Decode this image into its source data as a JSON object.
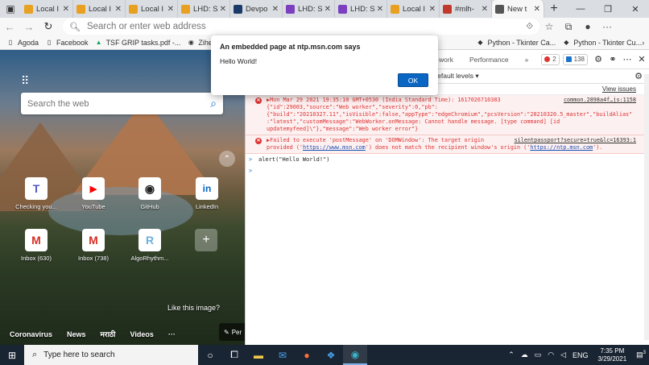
{
  "browser": {
    "tabs": [
      {
        "label": "Local I",
        "color": "#e8a020",
        "active": false
      },
      {
        "label": "Local I",
        "color": "#e8a020",
        "active": false
      },
      {
        "label": "Local I",
        "color": "#e8a020",
        "active": false
      },
      {
        "label": "LHD: S",
        "color": "#e8a020",
        "active": false
      },
      {
        "label": "Devpo",
        "color": "#1a3a6a",
        "active": false
      },
      {
        "label": "LHD: S",
        "color": "#7b3fbf",
        "active": false
      },
      {
        "label": "LHD: S",
        "color": "#7b3fbf",
        "active": false
      },
      {
        "label": "Local I",
        "color": "#e8a020",
        "active": false
      },
      {
        "label": "#mlh-",
        "color": "#c0392b",
        "active": false
      },
      {
        "label": "New t",
        "color": "#555555",
        "active": true
      }
    ],
    "address_placeholder": "Search or enter web address",
    "bookmarks": [
      "Agoda",
      "Facebook",
      "TSF GRIP tasks.pdf -...",
      "ZihengZZH",
      "Python - Tkinter Ca...",
      "Python - Tkinter Cu..."
    ]
  },
  "ntp": {
    "search_placeholder": "Search the web",
    "quick_links": [
      {
        "label": "Checking you...",
        "icon": "teams-icon",
        "glyph": "T",
        "color": "#5059c9"
      },
      {
        "label": "YouTube",
        "icon": "youtube-icon",
        "glyph": "▶",
        "color": "#ff0000"
      },
      {
        "label": "GitHub",
        "icon": "github-icon",
        "glyph": "◉",
        "color": "#222222"
      },
      {
        "label": "LinkedIn",
        "icon": "linkedin-icon",
        "glyph": "in",
        "color": "#0a66c2"
      },
      {
        "label": "Inbox (630)",
        "icon": "gmail-icon",
        "glyph": "M",
        "color": "#d93025"
      },
      {
        "label": "Inbox (738)",
        "icon": "gmail-icon",
        "glyph": "M",
        "color": "#d93025"
      },
      {
        "label": "AlgoRhythm...",
        "icon": "algorhythm-icon",
        "glyph": "R",
        "color": "#6ab0de"
      }
    ],
    "like_image": "Like this image?",
    "feed_tabs": [
      "Coronavirus",
      "News",
      "मराठी",
      "Videos",
      "···"
    ],
    "personalize": "Per"
  },
  "devtools": {
    "tabs": [
      "work",
      "Performance",
      "»"
    ],
    "error_count": "2",
    "message_count": "138",
    "levels": "Default levels ▾",
    "view_issues": "View issues",
    "errors": [
      {
        "source": "common.2898a4f…js:1158",
        "text": "▶Mon Mar 29 2021 19:35:10 GMT+0530 (India Standard Time): 1617026710383 {\"id\":29003,\"source\":\"Web worker\",\"severity\":0,\"pb\": {\"build\":\"20210327.11\",\"isVisible\":false,\"appType\":\"edgeChromium\",\"pcsVersion\":\"20210320.5_master\",\"buildAlias\" :\"latest\",\"customMessage\":\"WebWorker.onMessage: Cannot handle message. [type command] [id updatemyfeed]\\\"},\"message\":\"Web worker error\"}"
      },
      {
        "source": "silentpassport?secure=true&lc=16393:1",
        "text_pre": "▶Failed to execute 'postMessage' on 'DOMWindow': The target origin provided ('",
        "link1": "https://www.msn.com",
        "text_mid": "') does not match the recipient window's origin ('",
        "link2": "https://ntp.msn.com",
        "text_post": "')."
      }
    ],
    "console_input": "alert(\"Hello World!\")",
    "prompt_symbol": ">"
  },
  "dialog": {
    "title": "An embedded page at ntp.msn.com says",
    "message": "Hello World!",
    "ok_label": "OK"
  },
  "taskbar": {
    "search_placeholder": "Type here to search",
    "language": "ENG",
    "time": "7:35 PM",
    "date": "3/29/2021",
    "notification_count": "3"
  }
}
